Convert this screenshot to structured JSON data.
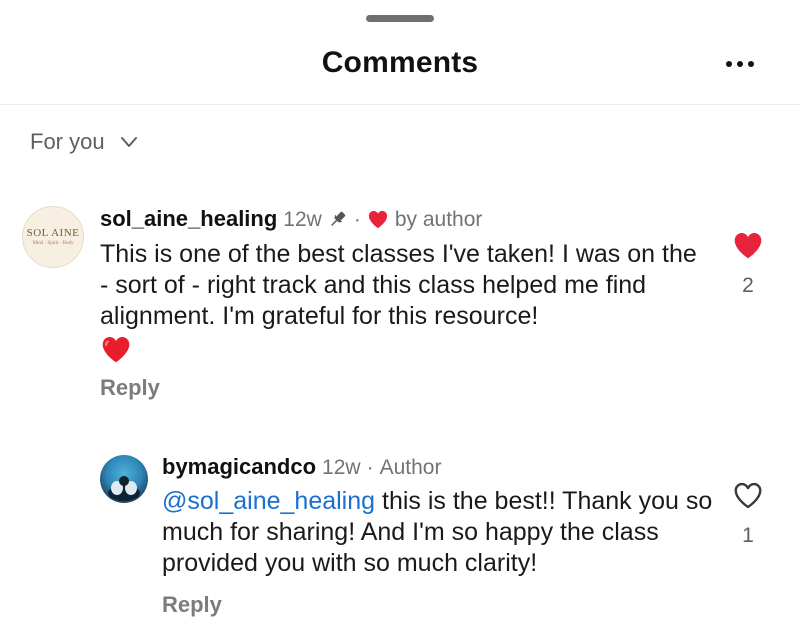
{
  "header": {
    "title": "Comments",
    "more_icon": "more-dots-icon"
  },
  "filter": {
    "label": "For you",
    "icon": "chevron-down-icon"
  },
  "colors": {
    "like_red": "#e8243c",
    "mention_blue": "#1a6fd1",
    "muted_gray": "#737373"
  },
  "comments": [
    {
      "username": "sol_aine_healing",
      "time": "12w",
      "dot": "·",
      "liked_by": "by author",
      "avatar_text": "SOL AINE",
      "avatar_subtext": "Mind · Spirit · Body",
      "text": "This is one of the best classes I've taken! I was on the - sort of - right track and this class helped me find alignment. I'm grateful for this resource!",
      "emoji": "red-heart-emoji",
      "reply_label": "Reply",
      "likes": "2",
      "liked": true
    },
    {
      "username": "bymagicandco",
      "time": "12w",
      "dot": "·",
      "role": "Author",
      "mention": "@sol_aine_healing",
      "text": " this is the best!! Thank you so much for sharing! And I'm so happy the class provided you with so much clarity!",
      "reply_label": "Reply",
      "likes": "1",
      "liked": false
    }
  ]
}
